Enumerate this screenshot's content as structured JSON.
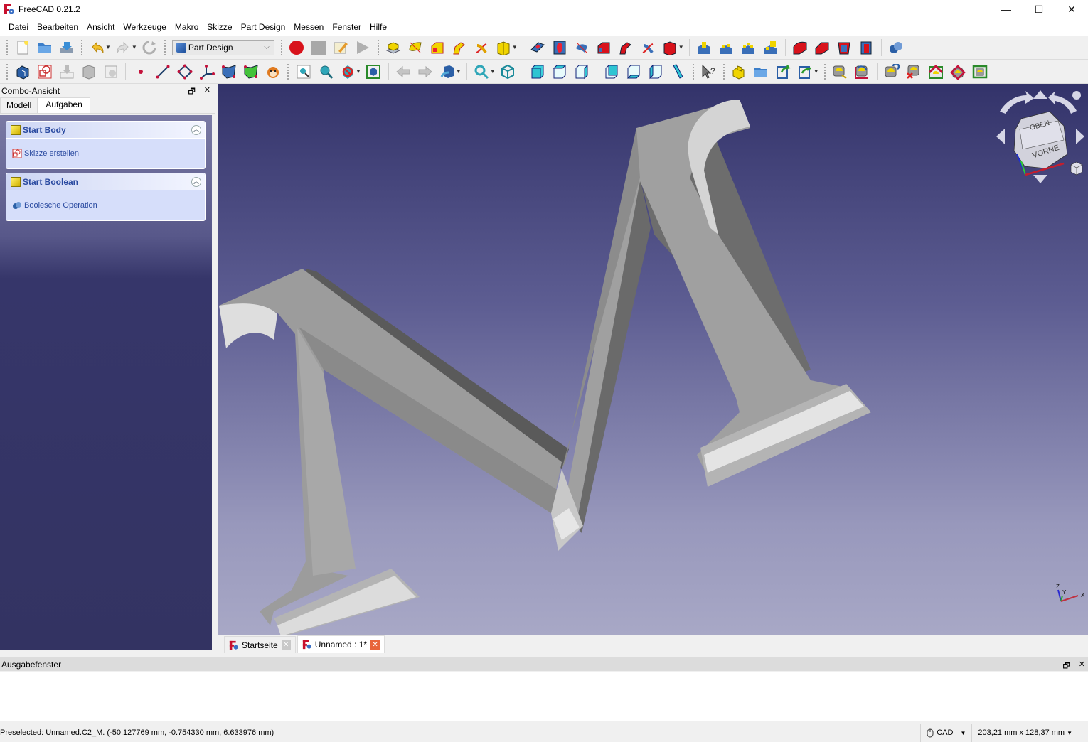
{
  "window": {
    "title": "FreeCAD 0.21.2",
    "controls": {
      "minimize": "—",
      "maximize": "☐",
      "close": "✕"
    }
  },
  "menubar": {
    "items": [
      "Datei",
      "Bearbeiten",
      "Ansicht",
      "Werkzeuge",
      "Makro",
      "Skizze",
      "Part Design",
      "Messen",
      "Fenster",
      "Hilfe"
    ]
  },
  "toolbar1": {
    "file_icons": [
      "new-document-icon",
      "open-icon",
      "save-icon"
    ],
    "edit_icons": [
      "undo-icon",
      "redo-icon",
      "refresh-icon"
    ],
    "workbench_selector": {
      "selected": "Part Design"
    },
    "macro_icons": [
      "record-macro-icon",
      "stop-macro-icon",
      "edit-macro-icon",
      "run-macro-icon"
    ],
    "partdesign_additive_icons": [
      "pad-icon",
      "revolution-icon",
      "additive-loft-icon",
      "additive-pipe-icon",
      "additive-helix-icon",
      "additive-primitive-icon"
    ],
    "partdesign_subtractive_icons": [
      "pocket-icon",
      "hole-icon",
      "groove-icon",
      "subtractive-loft-icon",
      "subtractive-pipe-icon",
      "subtractive-helix-icon",
      "subtractive-primitive-icon"
    ],
    "pattern_icons": [
      "mirrored-icon",
      "linear-pattern-icon",
      "polar-pattern-icon",
      "multi-transform-icon"
    ],
    "dressup_icons": [
      "fillet-icon",
      "chamfer-icon",
      "draft-icon",
      "thickness-icon"
    ],
    "boolean_icon": "boolean-icon"
  },
  "toolbar2": {
    "body_icons": [
      "body-icon",
      "create-sketch-icon",
      "validate-sketch-icon",
      "shape-binder-icon",
      "clone-icon"
    ],
    "datum_icons": [
      "datum-point-icon",
      "datum-line-icon",
      "datum-plane-icon",
      "local-cs-icon",
      "shape-binder-blue-icon",
      "subshape-binder-icon",
      "clone-animal-icon"
    ],
    "view_icons": [
      "fit-all-icon",
      "fit-selection-icon",
      "draw-style-icon",
      "bounding-box-icon"
    ],
    "nav_icons": [
      "back-icon",
      "forward-icon",
      "std-views-icon",
      "zoom-icon",
      "isometric-icon",
      "front-view-icon",
      "top-view-icon",
      "right-view-icon",
      "rear-view-icon",
      "bottom-view-icon",
      "left-view-icon",
      "measure-distance-icon"
    ],
    "help_icon": "whats-this-icon",
    "structure_icons": [
      "part-icon",
      "group-icon",
      "link-icon",
      "link-actions-icon"
    ],
    "measure_icons": [
      "measure-linear-icon",
      "measure-angular-icon",
      "measure-refresh-icon",
      "measure-clear-icon",
      "measure-toggle-all-icon",
      "measure-toggle-3d-icon",
      "measure-toggle-delta-icon"
    ]
  },
  "combo_view": {
    "title": "Combo-Ansicht",
    "tabs": [
      {
        "label": "Modell",
        "active": false
      },
      {
        "label": "Aufgaben",
        "active": true
      }
    ],
    "task_panels": [
      {
        "title": "Start Body",
        "action": "Skizze erstellen",
        "action_icon": "create-sketch-icon"
      },
      {
        "title": "Start Boolean",
        "action": "Boolesche Operation",
        "action_icon": "boolean-icon"
      }
    ]
  },
  "viewport": {
    "navcube": {
      "top_face": "OBEN",
      "front_face": "VORNE"
    },
    "axis_labels": {
      "x": "X",
      "y": "Y",
      "z": "Z"
    },
    "model_name": "C2_M"
  },
  "document_tabs": [
    {
      "label": "Startseite",
      "active": false
    },
    {
      "label": "Unnamed : 1*",
      "active": true
    }
  ],
  "output_window": {
    "title": "Ausgabefenster",
    "content": ""
  },
  "statusbar": {
    "message": "Preselected: Unnamed.C2_M. (-50.127769 mm, -0.754330 mm, 6.633976 mm)",
    "navigation_style": "CAD",
    "dimensions": "203,21 mm x 128,37 mm"
  },
  "colors": {
    "accent_blue": "#2a4aa0",
    "viewport_top": "#33336a",
    "viewport_bottom": "#a8a8c6",
    "model_gray": "#a0a0a0"
  }
}
